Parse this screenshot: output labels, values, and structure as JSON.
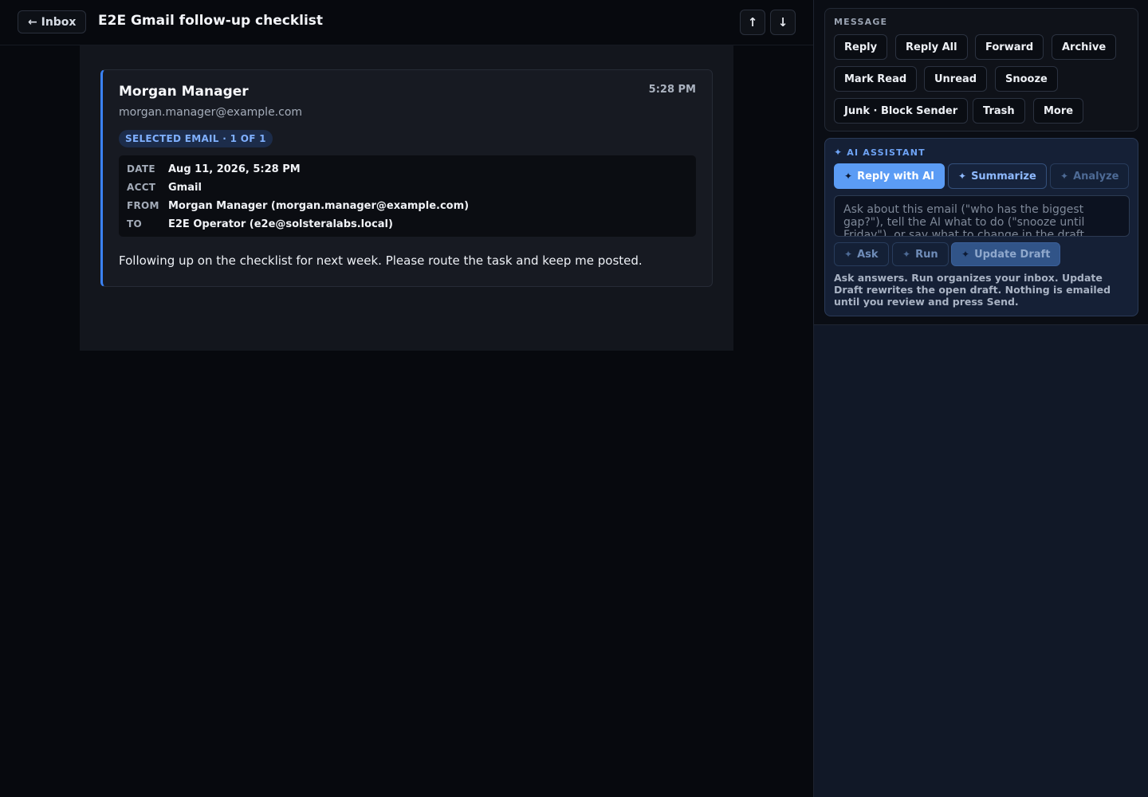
{
  "header": {
    "back_label": "← Inbox",
    "title": "E2E Gmail follow-up checklist",
    "prev_label": "↑",
    "next_label": "↓"
  },
  "email": {
    "sender_name": "Morgan Manager",
    "sender_email": "morgan.manager@example.com",
    "time": "5:28 PM",
    "badge": "SELECTED EMAIL · 1 OF 1",
    "meta": [
      {
        "label": "DATE",
        "value": "Aug 11, 2026, 5:28 PM"
      },
      {
        "label": "ACCT",
        "value": "Gmail"
      },
      {
        "label": "FROM",
        "value": "Morgan Manager (morgan.manager@example.com)"
      },
      {
        "label": "TO",
        "value": "E2E Operator (e2e@solsteralabs.local)"
      }
    ],
    "body": "Following up on the checklist for next week. Please route the task and keep me posted."
  },
  "message_panel": {
    "heading": "MESSAGE",
    "actions": [
      "Reply",
      "Reply All",
      "Forward",
      "Archive",
      "Mark Read",
      "Unread",
      "Snooze",
      "Junk · Block Sender",
      "Trash",
      "More"
    ]
  },
  "ai_panel": {
    "heading": "AI ASSISTANT",
    "spark_glyph": "✦",
    "quick_actions": [
      "Reply with AI",
      "Summarize",
      "Analyze"
    ],
    "input_placeholder": "Ask about this email (\"who has the biggest gap?\"), tell the AI what to do (\"snooze until Friday\"), or say what to change in the draft.",
    "run_actions": [
      "Ask",
      "Run",
      "Update Draft"
    ],
    "help_text": "Ask answers. Run organizes your inbox. Update Draft rewrites the open draft. Nothing is emailed until you review and press Send."
  },
  "colors": {
    "accent": "#3b82f6",
    "ai_primary": "#5b9cf5",
    "background": "#07090e"
  }
}
